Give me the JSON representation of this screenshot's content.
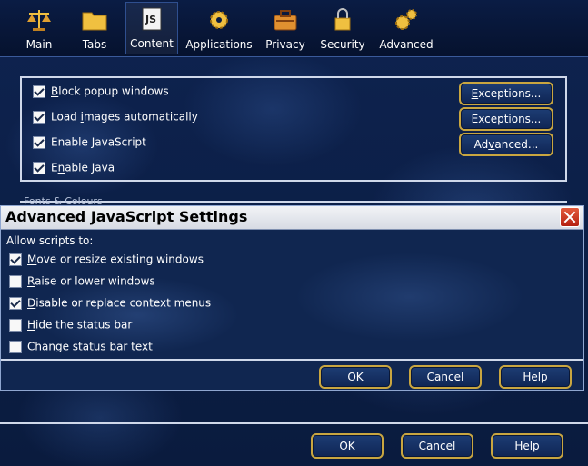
{
  "toolbar": {
    "items": [
      {
        "label": "Main",
        "icon": "scales-icon"
      },
      {
        "label": "Tabs",
        "icon": "folder-tab-icon"
      },
      {
        "label": "Content",
        "icon": "content-js-icon"
      },
      {
        "label": "Applications",
        "icon": "gear-applications-icon"
      },
      {
        "label": "Privacy",
        "icon": "privacy-briefcase-icon"
      },
      {
        "label": "Security",
        "icon": "padlock-icon"
      },
      {
        "label": "Advanced",
        "icon": "gears-icon"
      }
    ],
    "active": "Content"
  },
  "content": {
    "block_popups": {
      "pre": "",
      "u": "B",
      "post": "lock popup windows",
      "checked": true
    },
    "load_images": {
      "pre": "Load ",
      "u": "i",
      "post": "mages automatically",
      "checked": true
    },
    "enable_js": {
      "pre": "Enable ",
      "u": "J",
      "post": "avaScript",
      "checked": true
    },
    "enable_java": {
      "pre": "E",
      "u": "n",
      "post": "able Java",
      "checked": true
    },
    "exceptions1": {
      "pre": "",
      "u": "E",
      "post": "xceptions..."
    },
    "exceptions2": {
      "pre": "E",
      "u": "x",
      "post": "ceptions..."
    },
    "advanced": {
      "pre": "Ad",
      "u": "v",
      "post": "anced..."
    },
    "legend": "Fonts & Colours"
  },
  "dialog": {
    "title": "Advanced JavaScript Settings",
    "allow_label": "Allow scripts to:",
    "options": [
      {
        "pre": "",
        "u": "M",
        "post": "ove or resize existing windows",
        "checked": true
      },
      {
        "pre": "",
        "u": "R",
        "post": "aise or lower windows",
        "checked": false
      },
      {
        "pre": "",
        "u": "D",
        "post": "isable or replace context menus",
        "checked": true
      },
      {
        "pre": "",
        "u": "H",
        "post": "ide the status bar",
        "checked": false
      },
      {
        "pre": "",
        "u": "C",
        "post": "hange status bar text",
        "checked": false
      }
    ],
    "ok": "OK",
    "cancel": "Cancel",
    "help_u": "H",
    "help_post": "elp"
  },
  "footer": {
    "ok": "OK",
    "cancel": "Cancel",
    "help_u": "H",
    "help_post": "elp"
  },
  "colors": {
    "background": "#0c1f45",
    "button_border": "#c9a640",
    "panel_border": "#cfd8ea"
  }
}
